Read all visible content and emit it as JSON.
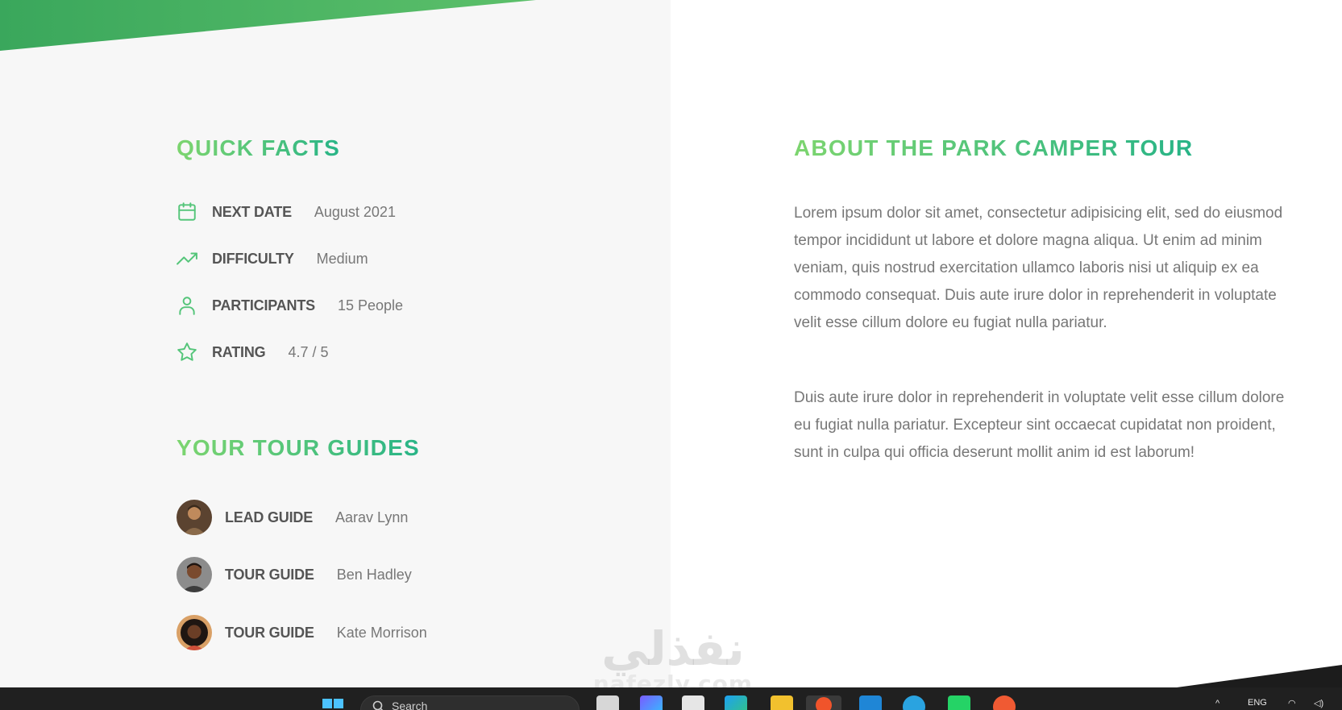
{
  "quick_facts": {
    "heading": "QUICK FACTS",
    "items": [
      {
        "icon": "calendar-icon",
        "label": "NEXT DATE",
        "value": "August 2021"
      },
      {
        "icon": "trending-up-icon",
        "label": "DIFFICULTY",
        "value": "Medium"
      },
      {
        "icon": "user-icon",
        "label": "PARTICIPANTS",
        "value": "15 People"
      },
      {
        "icon": "star-icon",
        "label": "RATING",
        "value": "4.7 / 5"
      }
    ]
  },
  "tour_guides": {
    "heading": "YOUR TOUR GUIDES",
    "items": [
      {
        "role": "LEAD GUIDE",
        "name": "Aarav Lynn"
      },
      {
        "role": "TOUR GUIDE",
        "name": "Ben Hadley"
      },
      {
        "role": "TOUR GUIDE",
        "name": "Kate Morrison"
      }
    ]
  },
  "about": {
    "heading": "ABOUT THE PARK CAMPER TOUR",
    "paragraphs": [
      "Lorem ipsum dolor sit amet, consectetur adipisicing elit, sed do eiusmod tempor incididunt ut labore et dolore magna aliqua. Ut enim ad minim veniam, quis nostrud exercitation ullamco laboris nisi ut aliquip ex ea commodo consequat. Duis aute irure dolor in reprehenderit in voluptate velit esse cillum dolore eu fugiat nulla pariatur.",
      "Duis aute irure dolor in reprehenderit in voluptate velit esse cillum dolore eu fugiat nulla pariatur. Excepteur sint occaecat cupidatat non proident, sunt in culpa qui officia deserunt mollit anim id est laborum!"
    ]
  },
  "watermark": {
    "arabic": "نفذلي",
    "latin": "nafezly.com"
  },
  "taskbar": {
    "search_placeholder": "Search",
    "tray_language": "ENG"
  },
  "colors": {
    "accent_start": "#7dd56f",
    "accent_end": "#28b487"
  }
}
